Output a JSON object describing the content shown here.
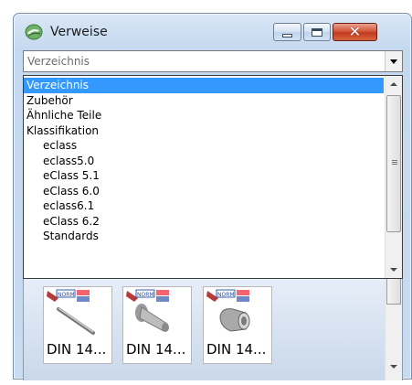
{
  "window": {
    "title": "Verweise",
    "title_icon": "app-icon",
    "close_label": "✕"
  },
  "combo": {
    "value": "Verzeichnis"
  },
  "dropdown": {
    "items": [
      {
        "label": "Verzeichnis",
        "selected": true,
        "indent": false
      },
      {
        "label": "Zubehör",
        "selected": false,
        "indent": false
      },
      {
        "label": "Ähnliche Teile",
        "selected": false,
        "indent": false
      },
      {
        "label": "Klassifikation",
        "selected": false,
        "indent": false
      },
      {
        "label": "eclass",
        "selected": false,
        "indent": true
      },
      {
        "label": "eclass5.0",
        "selected": false,
        "indent": true
      },
      {
        "label": "eClass 5.1",
        "selected": false,
        "indent": true
      },
      {
        "label": "eClass 6.0",
        "selected": false,
        "indent": true
      },
      {
        "label": "eclass6.1",
        "selected": false,
        "indent": true
      },
      {
        "label": "eClass 6.2",
        "selected": false,
        "indent": true
      },
      {
        "label": "Standards",
        "selected": false,
        "indent": true
      }
    ]
  },
  "tiles": [
    {
      "label": "DIN 14...",
      "icon": "pin-part-icon"
    },
    {
      "label": "DIN 14...",
      "icon": "bolt-part-icon"
    },
    {
      "label": "DIN 14...",
      "icon": "sleeve-part-icon"
    }
  ],
  "colors": {
    "selection": "#3399ff",
    "close_button": "#c23a1d"
  }
}
